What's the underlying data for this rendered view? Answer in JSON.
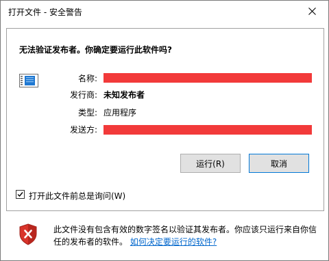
{
  "window": {
    "title": "打开文件 - 安全警告"
  },
  "dialog": {
    "heading": "无法验证发布者。你确定要运行此软件吗?",
    "fields": {
      "name_label": "名称:",
      "publisher_label": "发行商:",
      "publisher_value": "未知发布者",
      "type_label": "类型:",
      "type_value": "应用程序",
      "from_label": "发送方:"
    },
    "buttons": {
      "run": "运行(R)",
      "cancel": "取消"
    },
    "checkbox": {
      "label": "打开此文件前总是询问(W)",
      "checked": true
    }
  },
  "footer": {
    "warning_text": "此文件没有包含有效的数字签名以验证其发布者。你应该只运行来自你信任的发布者的软件。",
    "link_text": "如何决定要运行的软件?"
  },
  "colors": {
    "redaction": "#f23a3a",
    "link": "#0066cc",
    "default_button_border": "#0078d7"
  },
  "icons": [
    "application-icon",
    "close-icon",
    "shield-warning-icon",
    "checkmark-icon"
  ]
}
